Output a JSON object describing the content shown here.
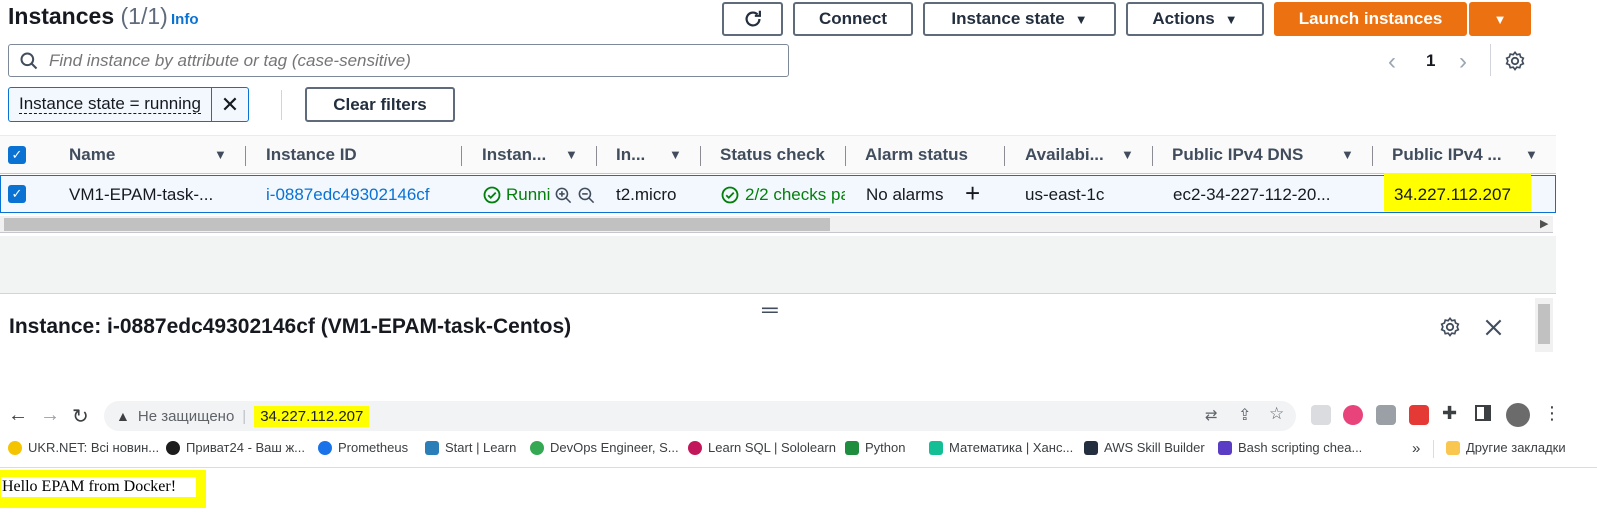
{
  "header": {
    "title": "Instances",
    "count": "(1/1)",
    "info": "Info",
    "buttons": {
      "connect": "Connect",
      "instance_state": "Instance state",
      "actions": "Actions",
      "launch": "Launch instances"
    }
  },
  "search": {
    "placeholder": "Find instance by attribute or tag (case-sensitive)"
  },
  "pagination": {
    "page": "1"
  },
  "filter": {
    "token": "Instance state = running",
    "clear": "Clear filters"
  },
  "table": {
    "columns": [
      "Name",
      "Instance ID",
      "Instan...",
      "In...",
      "Status check",
      "Alarm status",
      "Availabi...",
      "Public IPv4 DNS",
      "Public IPv4 ..."
    ],
    "row": {
      "name": "VM1-EPAM-task-...",
      "instance_id": "i-0887edc49302146cf",
      "state": "Runni",
      "type": "t2.micro",
      "status_check": "2/2 checks pa",
      "alarm": "No alarms",
      "az": "us-east-1c",
      "dns": "ec2-34-227-112-20...",
      "ip": "34.227.112.207"
    }
  },
  "details": {
    "title": "Instance: i-0887edc49302146cf (VM1-EPAM-task-Centos)"
  },
  "browser": {
    "security": "Не защищено",
    "url": "34.227.112.207",
    "bookmarks": [
      {
        "label": "UKR.NET: Всі новин...",
        "color": "#f5c400"
      },
      {
        "label": "Приват24 - Ваш ж...",
        "color": "#1d1d1d"
      },
      {
        "label": "Prometheus",
        "color": "#1a73e8"
      },
      {
        "label": "Start | Learn",
        "color": "#2a7fb8"
      },
      {
        "label": "DevOps Engineer, S...",
        "color": "#34a853"
      },
      {
        "label": "Learn SQL | Sololearn",
        "color": "#c2185b"
      },
      {
        "label": "Python",
        "color": "#1e8e3e"
      },
      {
        "label": "Математика | Ханс...",
        "color": "#14bf96"
      },
      {
        "label": "AWS Skill Builder",
        "color": "#232f3e"
      },
      {
        "label": "Bash scripting chea...",
        "color": "#5b3cc4"
      }
    ],
    "more": "»",
    "other_bookmarks": "Другие закладки"
  },
  "page": {
    "text": "Hello EPAM from Docker!"
  },
  "colors": {
    "accent": "#ec7211",
    "link": "#0972d3",
    "success": "#037f0c",
    "highlight": "#ffff00"
  }
}
